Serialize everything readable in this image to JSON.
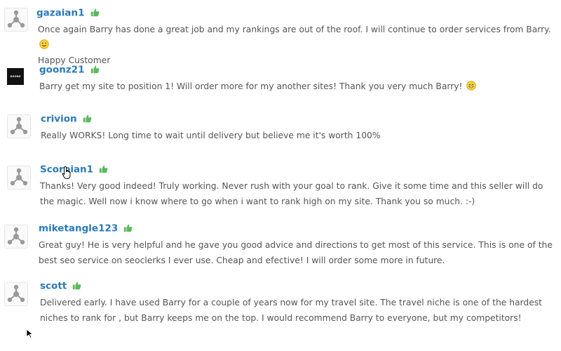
{
  "reviews": [
    {
      "username": "gazaian1",
      "text": "Once again Barry has done a great job and my rankings are out of the roof. I will continue to order services from Barry.",
      "text_cont": "Happy Customer",
      "emoji": "smile-emoji-icon",
      "rating": "thumbs-up-icon"
    },
    {
      "username": "goonz21",
      "text": "Barry get my site to position 1! Will order more for my another sites! Thank you very much Barry!",
      "emoji": "grin-emoji-icon",
      "avatar_logo_text": "GOONZ",
      "rating": "thumbs-up-icon"
    },
    {
      "username": "crivion",
      "text": "Really WORKS! Long time to wait until delivery but believe me it's worth 100%",
      "rating": "thumbs-up-icon"
    },
    {
      "username": "Scorpian1",
      "text": "Thanks! Very good indeed! Truly working. Never rush with your goal to rank. Give it some time and this seller will do the magic. Well now i know where to go when i want to rank high on my site. Thank you so much. :-)",
      "rating": "thumbs-up-icon"
    },
    {
      "username": "miketangle123",
      "text": "Great guy! He is very helpful and he gave you good advice and directions to get most of this service. This is one of the best seo service on seoclerks I ever use. Cheap and efective! I will order some more in future.",
      "rating": "thumbs-up-icon"
    },
    {
      "username": "scott",
      "text": "Delivered early. I have used Barry for a couple of years now for my travel site. The travel niche is one of the hardest niches to rank for , but Barry keeps me on the top. I would recommend Barry to everyone, but my competitors!",
      "rating": "thumbs-up-icon"
    }
  ],
  "colors": {
    "username": "#2a7ab7",
    "thumb": "#5cb85c",
    "text": "#555555",
    "avatar_icon": "#9a9a9a"
  }
}
